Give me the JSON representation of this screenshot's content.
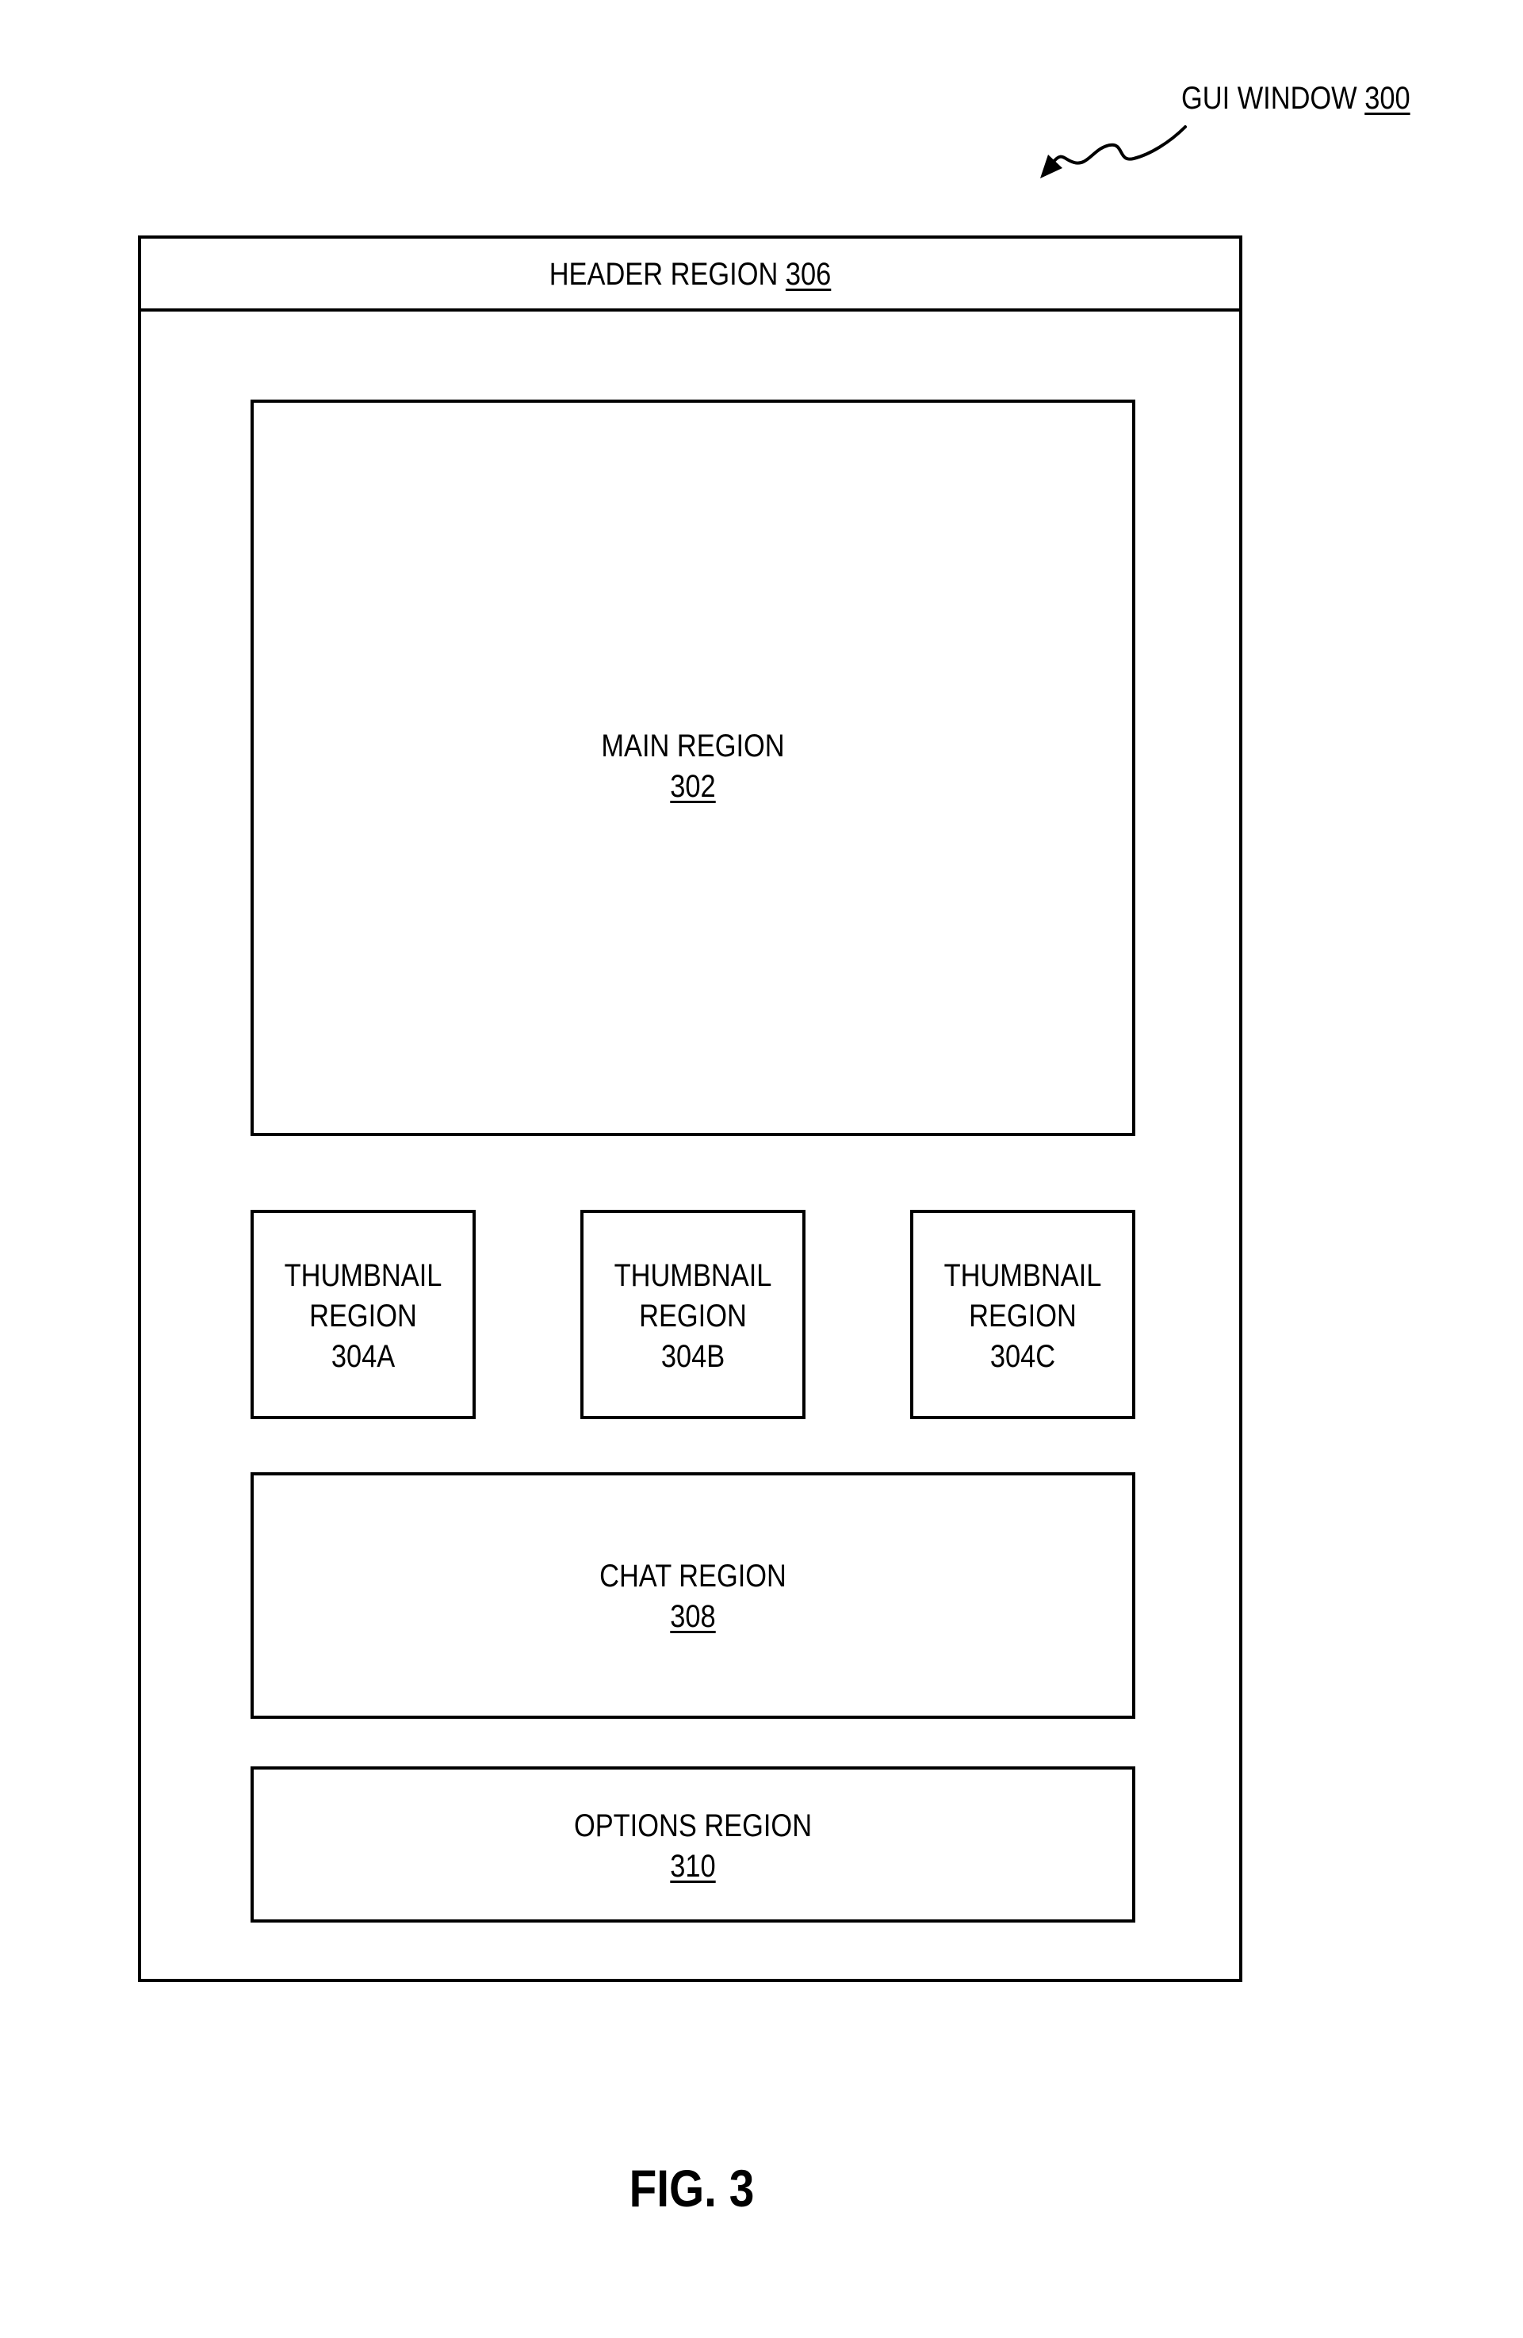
{
  "window_label": {
    "text": "GUI WINDOW ",
    "ref": "300"
  },
  "header": {
    "text": "HEADER REGION ",
    "ref": "306"
  },
  "main": {
    "text": "MAIN REGION",
    "ref": "302"
  },
  "thumbnails": [
    {
      "line1": "THUMBNAIL",
      "line2": "REGION",
      "line3": "304A"
    },
    {
      "line1": "THUMBNAIL",
      "line2": "REGION",
      "line3": "304B"
    },
    {
      "line1": "THUMBNAIL",
      "line2": "REGION",
      "line3": "304C"
    }
  ],
  "chat": {
    "text": "CHAT REGION",
    "ref": "308"
  },
  "options": {
    "text": "OPTIONS REGION",
    "ref": "310"
  },
  "figure_caption": "FIG. 3",
  "icons": {
    "pointer": "squiggly-arrow-icon"
  }
}
